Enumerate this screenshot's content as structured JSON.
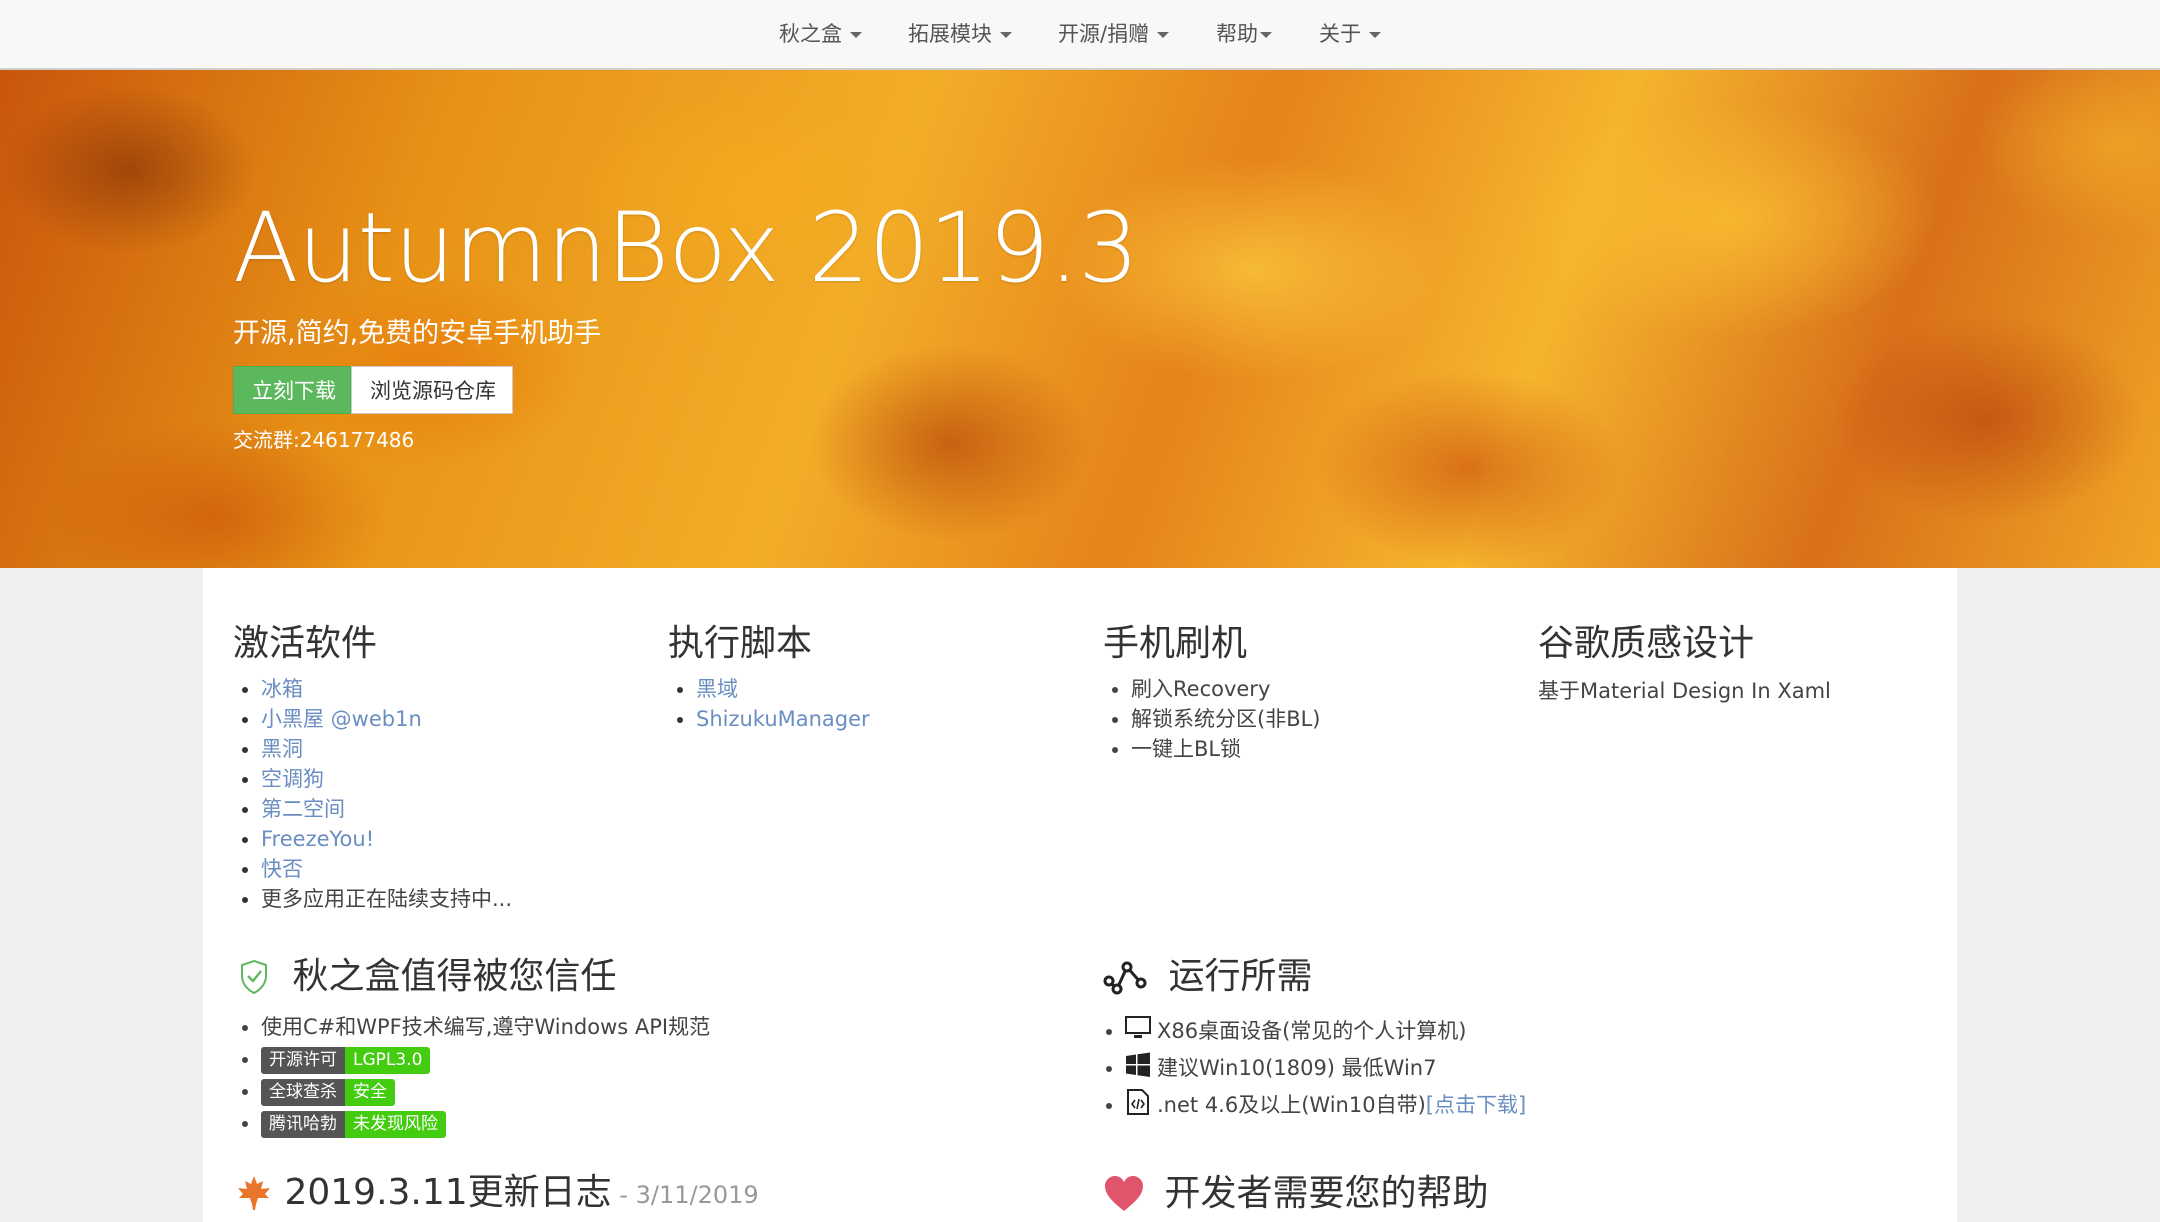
{
  "nav": {
    "items": [
      {
        "label": "秋之盒",
        "dropdown": true
      },
      {
        "label": "拓展模块",
        "dropdown": true
      },
      {
        "label": "开源/捐赠",
        "dropdown": true
      },
      {
        "label": "帮助",
        "dropdown": true
      },
      {
        "label": "关于",
        "dropdown": true
      }
    ]
  },
  "hero": {
    "title": "AutumnBox 2019.3",
    "subtitle": "开源,简约,免费的安卓手机助手",
    "download_label": "立刻下载",
    "repo_label": "浏览源码仓库",
    "qq_group": "交流群:246177486"
  },
  "features": {
    "activate": {
      "title": "激活软件",
      "items": [
        "冰箱",
        "小黑屋 @web1n",
        "黑洞",
        "空调狗",
        "第二空间",
        "FreezeYou!",
        "快否"
      ],
      "more": "更多应用正在陆续支持中..."
    },
    "scripts": {
      "title": "执行脚本",
      "items": [
        "黑域",
        "ShizukuManager"
      ]
    },
    "flash": {
      "title": "手机刷机",
      "items": [
        "刷入Recovery",
        "解锁系统分区(非BL)",
        "一键上BL锁"
      ]
    },
    "design": {
      "title": "谷歌质感设计",
      "desc": "基于Material Design In Xaml"
    }
  },
  "trust": {
    "title": "秋之盒值得被您信任",
    "items": [
      "使用C#和WPF技术编写,遵守Windows API规范"
    ],
    "badges": [
      {
        "label": "开源许可",
        "value": "LGPL3.0"
      },
      {
        "label": "全球查杀",
        "value": "安全"
      },
      {
        "label": "腾讯哈勃",
        "value": "未发现风险"
      }
    ]
  },
  "requirements": {
    "title": "运行所需",
    "items": [
      {
        "icon": "monitor-icon",
        "text": "X86桌面设备(常见的个人计算机)"
      },
      {
        "icon": "windows-icon",
        "text": "建议Win10(1809) 最低Win7"
      },
      {
        "icon": "code-file-icon",
        "text": ".net 4.6及以上(Win10自带)",
        "link": "[点击下载]"
      }
    ]
  },
  "changelog": {
    "title": "2019.3.11更新日志",
    "date": " - 3/11/2019"
  },
  "help": {
    "title": "开发者需要您的帮助"
  },
  "colors": {
    "link": "#6a8ec1",
    "download_button": "#5cb85c",
    "badge_left": "#555555",
    "badge_right": "#44cc11",
    "shield": "#5cb85c",
    "heart": "#e0556b",
    "leaf": "#e8752a"
  }
}
